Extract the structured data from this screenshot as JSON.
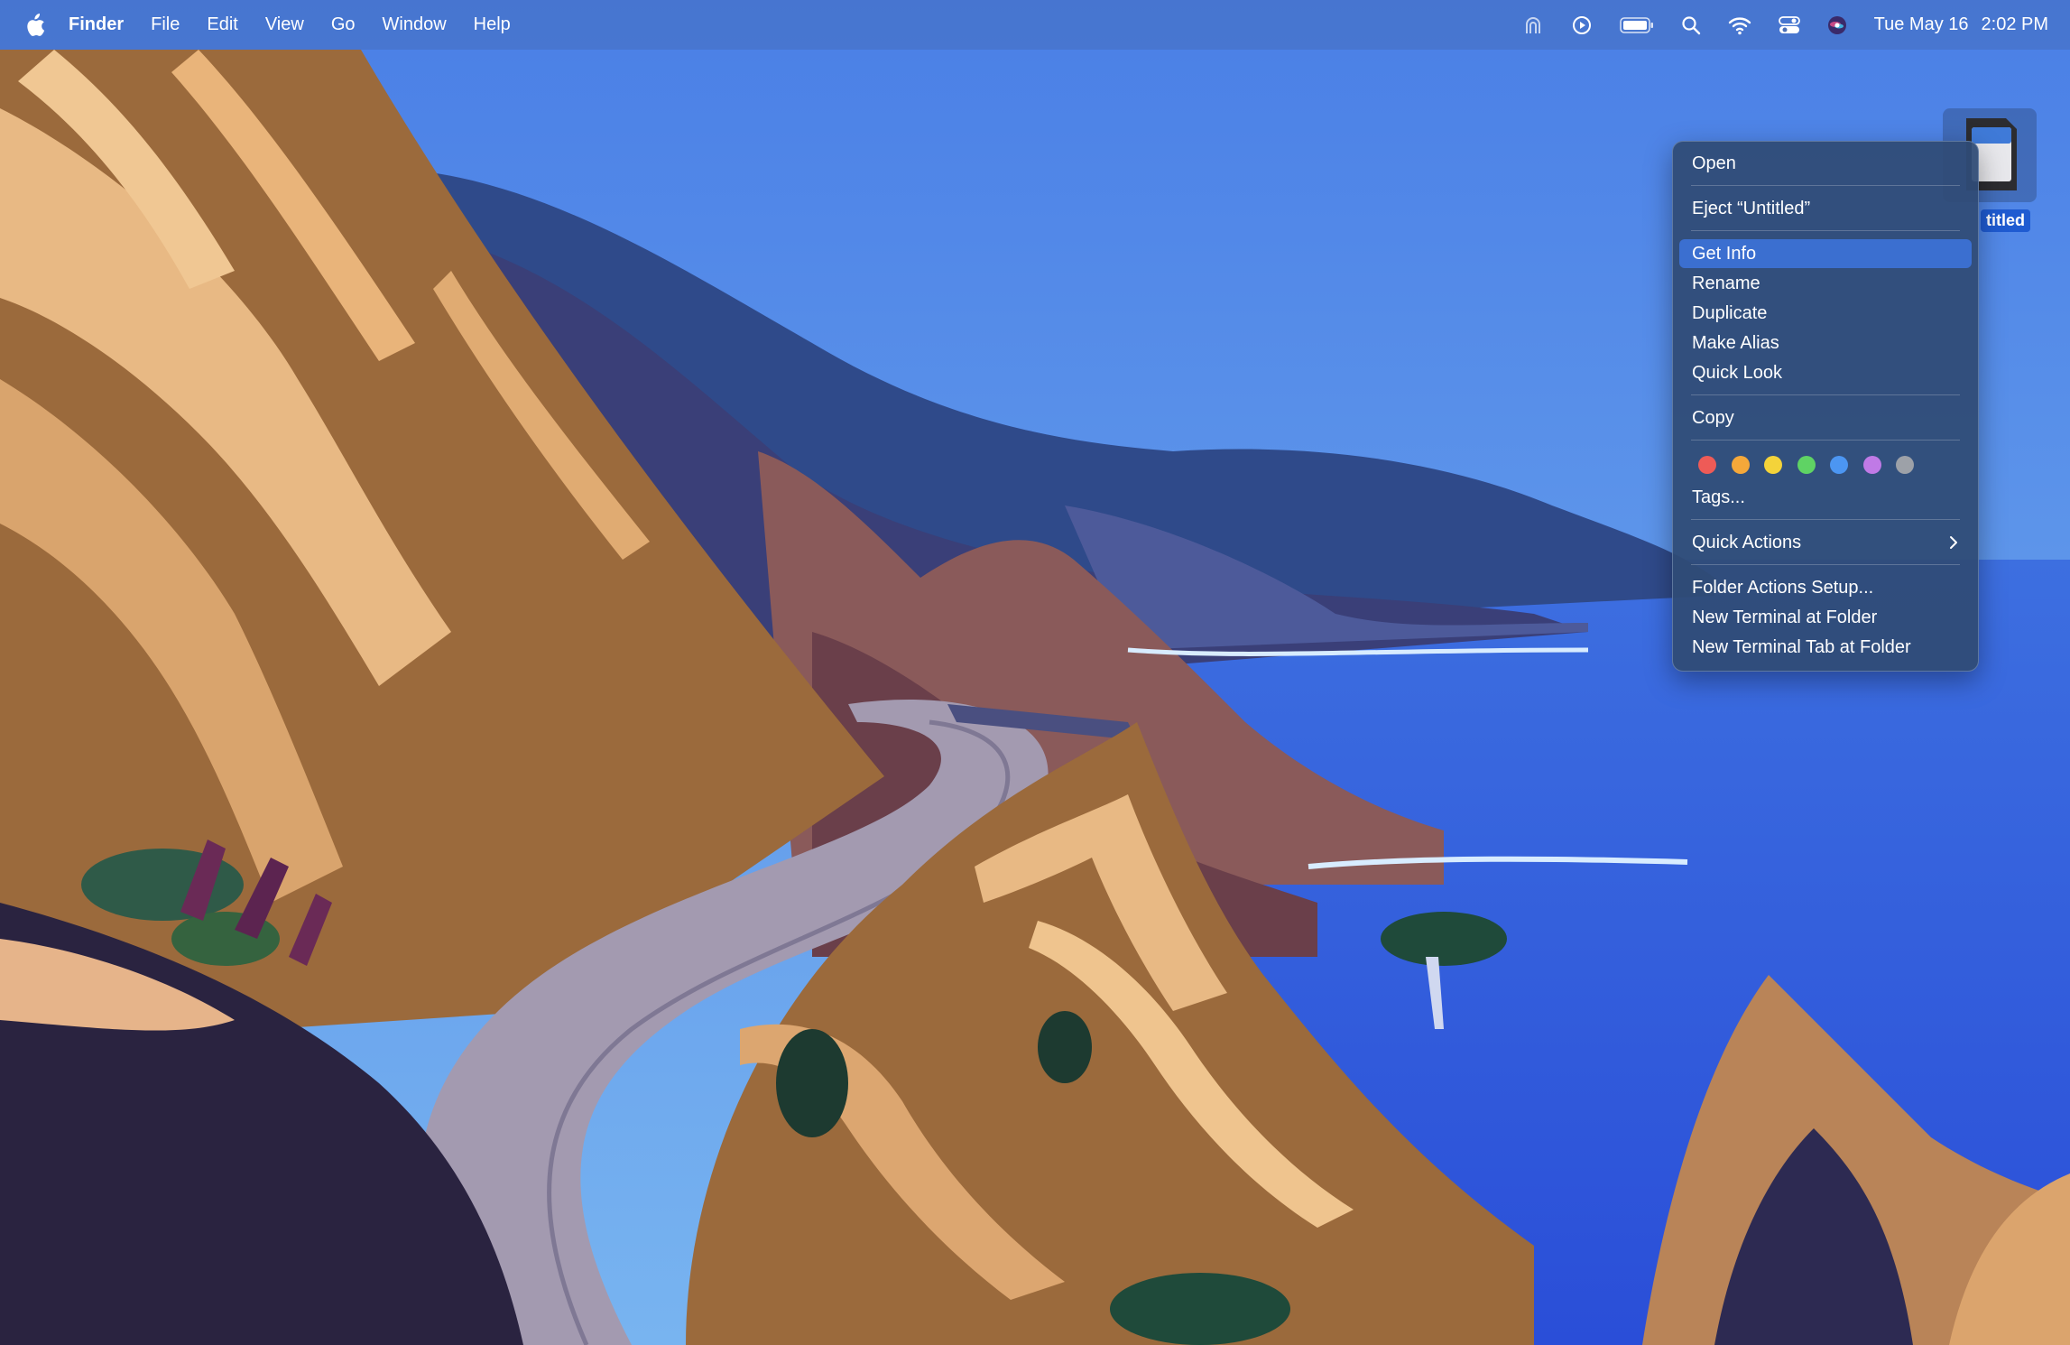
{
  "menubar": {
    "app_name": "Finder",
    "menus": [
      "File",
      "Edit",
      "View",
      "Go",
      "Window",
      "Help"
    ],
    "status_icons": [
      "airdrop-icon",
      "play-circle-icon",
      "battery-icon",
      "search-icon",
      "wifi-icon",
      "control-center-icon",
      "siri-icon"
    ],
    "date": "Tue May 16",
    "time": "2:02 PM"
  },
  "desktop_icon": {
    "label": "titled"
  },
  "context_menu": {
    "open": "Open",
    "eject": "Eject “Untitled”",
    "get_info": "Get Info",
    "rename": "Rename",
    "duplicate": "Duplicate",
    "make_alias": "Make Alias",
    "quick_look": "Quick Look",
    "copy": "Copy",
    "tag_colors": [
      "#ee5b57",
      "#f5a83a",
      "#f4d33a",
      "#5fd364",
      "#4c96f2",
      "#c07ae6",
      "#9da1a8"
    ],
    "tags": "Tags...",
    "quick_actions": "Quick Actions",
    "folder_actions_setup": "Folder Actions Setup...",
    "new_terminal_at_folder": "New Terminal at Folder",
    "new_terminal_tab_at_folder": "New Terminal Tab at Folder"
  }
}
